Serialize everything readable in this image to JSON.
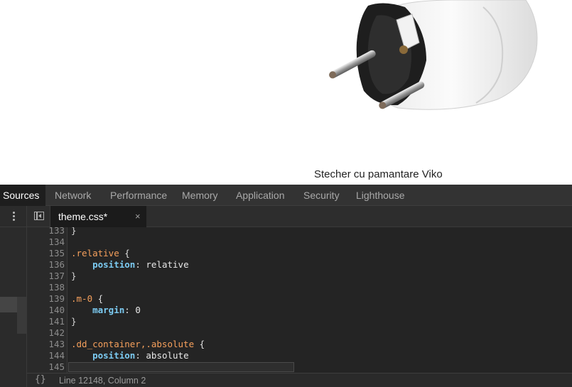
{
  "webpage": {
    "product_caption": "Stecher cu pamantare Viko"
  },
  "devtools": {
    "panel_tabs": [
      {
        "label": "Sources",
        "active": true
      },
      {
        "label": "Network",
        "active": false
      },
      {
        "label": "Performance",
        "active": false
      },
      {
        "label": "Memory",
        "active": false
      },
      {
        "label": "Application",
        "active": false
      },
      {
        "label": "Security",
        "active": false
      },
      {
        "label": "Lighthouse",
        "active": false
      }
    ],
    "navigator": {
      "menu_icon": "kebab-menu-icon",
      "toggle_icon": "toggle-navigator-icon"
    },
    "editor": {
      "open_file": {
        "name": "theme.css*",
        "close_glyph": "×"
      },
      "lines": [
        {
          "num": "133",
          "text": "}"
        },
        {
          "num": "134",
          "text": ""
        },
        {
          "num": "135",
          "text": ".relative {"
        },
        {
          "num": "136",
          "text": "    position: relative"
        },
        {
          "num": "137",
          "text": "}"
        },
        {
          "num": "138",
          "text": ""
        },
        {
          "num": "139",
          "text": ".m-0 {"
        },
        {
          "num": "140",
          "text": "    margin: 0"
        },
        {
          "num": "141",
          "text": "}"
        },
        {
          "num": "142",
          "text": ""
        },
        {
          "num": "143",
          "text": ".dd_container,.absolute {"
        },
        {
          "num": "144",
          "text": "    position: absolute"
        },
        {
          "num": "145",
          "text": ""
        }
      ]
    },
    "status_bar": {
      "format_icon": "{}",
      "cursor_position": "Line 12148, Column 2"
    },
    "colors": {
      "selector": "#f6a05c",
      "property": "#7ccbf2",
      "active_tab_bg": "#1e1e1e"
    }
  }
}
